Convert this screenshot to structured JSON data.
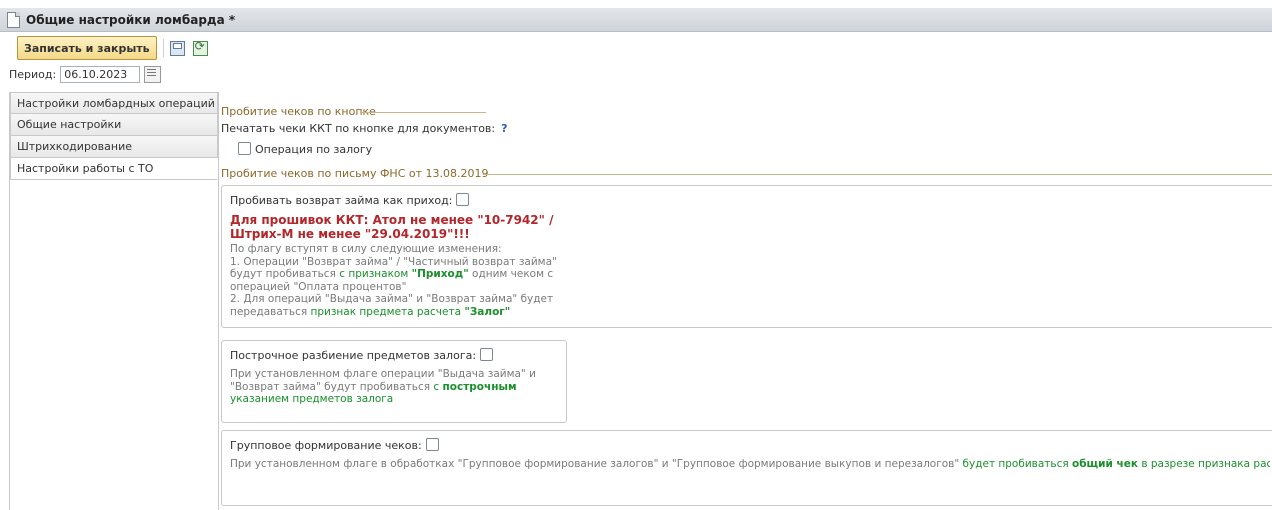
{
  "window": {
    "title": "Общие настройки ломбарда *"
  },
  "toolbar": {
    "save_close_label": "Записать и закрыть"
  },
  "period": {
    "label": "Период:",
    "value": "06.10.2023"
  },
  "tabs": [
    {
      "label": "Настройки ломбардных операций"
    },
    {
      "label": "Общие настройки"
    },
    {
      "label": "Штрихкодирование"
    },
    {
      "label": "Настройки работы с ТО"
    }
  ],
  "section1": {
    "legend": "Пробитие чеков по кнопке",
    "print_label": "Печатать чеки ККТ по кнопке для документов:",
    "help": "?",
    "pledge_op_label": "Операция по залогу"
  },
  "section2": {
    "legend": "Пробитие чеков по письму ФНС от 13.08.2019",
    "box1": {
      "title": "Пробивать возврат займа как приход:",
      "warn_line1": "Для прошивок ККТ: Атол не менее \"10-7942\" /",
      "warn_line2": "Штрих-М не менее \"29.04.2019\"!!!",
      "d1": "По флагу вступят в силу следующие изменения:",
      "d2": "1. Операции \"Возврат займа\" / \"Частичный возврат займа\"",
      "d3a": "будут пробиваться ",
      "d3b": "с признаком ",
      "d3c": "\"Приход\"",
      "d3d": " одним чеком с",
      "d4": "операцией \"Оплата процентов\"",
      "d5": "2. Для операций \"Выдача займа\" и \"Возврат займа\" будет",
      "d6a": "передаваться ",
      "d6b": "признак предмета расчета ",
      "d6c": "\"Залог\""
    },
    "box2": {
      "title": "Построчное разбиение предметов залога:",
      "d1": "При установленном флаге операции \"Выдача займа\" и",
      "d2a": "\"Возврат займа\" будут пробиваться ",
      "d2b": "с ",
      "d2c": "построчным",
      "d3": "указанием предметов залога"
    },
    "box3": {
      "title": "Групповое формирование чеков:",
      "d1a": "При установленном флаге в обработках \"Групповое формирование залогов\" и \"Групповое формирование выкупов и перезалогов\" ",
      "d1b": "будет пробиваться ",
      "d1c": "общий чек",
      "d1d": " в разрезе признака расчета ККТ и"
    }
  }
}
